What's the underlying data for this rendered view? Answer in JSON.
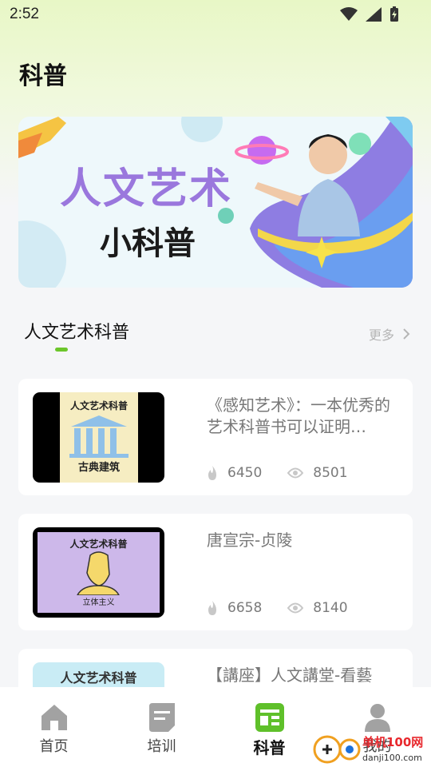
{
  "status_bar": {
    "time": "2:52"
  },
  "page": {
    "title": "科普"
  },
  "banner": {
    "title": "人文艺术",
    "subtitle": "小科普"
  },
  "section": {
    "title": "人文艺术科普",
    "more_label": "更多"
  },
  "articles": [
    {
      "title": "《感知艺术》：一本优秀的艺术科普书可以证明…",
      "likes": "6450",
      "views": "8501",
      "thumb_header": "人文艺术科普",
      "thumb_caption": "古典建筑"
    },
    {
      "title": "唐宣宗-贞陵",
      "likes": "6658",
      "views": "8140",
      "thumb_header": "人文艺术科普",
      "thumb_caption": "立体主义"
    },
    {
      "title": "【講座】人文講堂-看藝",
      "thumb_header": "人文艺术科普"
    }
  ],
  "tabbar": {
    "items": [
      {
        "label": "首页",
        "icon": "home-icon"
      },
      {
        "label": "培训",
        "icon": "training-icon"
      },
      {
        "label": "科普",
        "icon": "science-icon",
        "active": true
      },
      {
        "label": "我的",
        "icon": "profile-icon"
      }
    ]
  },
  "watermark": {
    "domain": "danji100.com",
    "brand": "单机100网"
  },
  "colors": {
    "accent": "#6cc62b",
    "banner_title": "#9a77dd",
    "header_gradient": "#e8f7c6"
  }
}
